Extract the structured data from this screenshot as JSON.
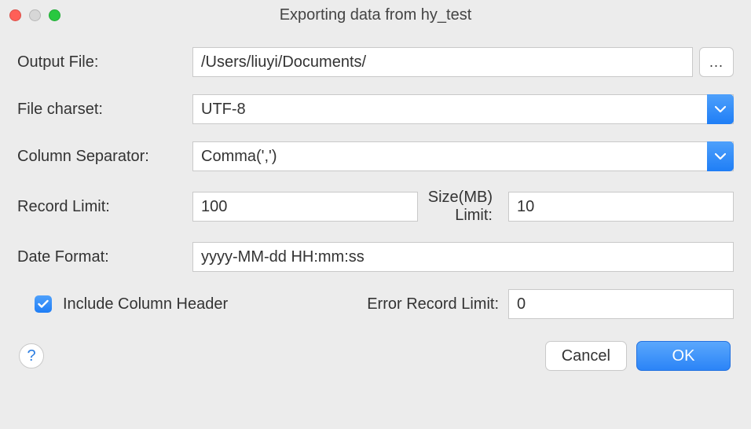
{
  "window": {
    "title": "Exporting data from hy_test"
  },
  "form": {
    "outputFile": {
      "label": "Output File:",
      "value": "/Users/liuyi/Documents/",
      "browseLabel": "..."
    },
    "fileCharset": {
      "label": "File charset:",
      "value": "UTF-8"
    },
    "columnSeparator": {
      "label": "Column Separator:",
      "value": "Comma(',')"
    },
    "recordLimit": {
      "label": "Record Limit:",
      "value": "100"
    },
    "sizeLimit": {
      "label": "Size(MB) Limit:",
      "value": "10"
    },
    "dateFormat": {
      "label": "Date Format:",
      "value": "yyyy-MM-dd HH:mm:ss"
    },
    "includeHeader": {
      "label": "Include Column Header",
      "checked": true
    },
    "errorRecordLimit": {
      "label": "Error Record Limit:",
      "value": "0"
    }
  },
  "buttons": {
    "help": "?",
    "cancel": "Cancel",
    "ok": "OK"
  }
}
